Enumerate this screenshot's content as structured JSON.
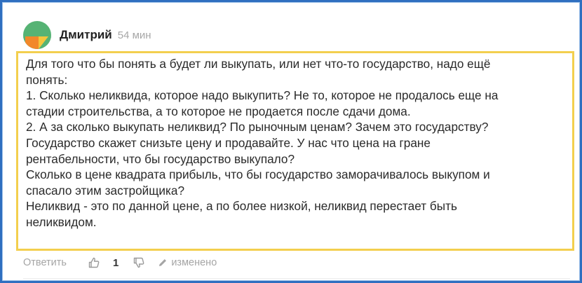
{
  "comment": {
    "author": "Дмитрий",
    "time": "54 мин",
    "avatar_icon": "avatar-circle",
    "avatar_colors": [
      "#56b374",
      "#f2882a",
      "#f4c63c"
    ],
    "body_lines": [
      "Для того что бы понять а будет ли выкупать, или нет что-то государство, надо ещё",
      "понять:",
      "1. Сколько неликвида, которое надо выкупить? Не то, которое не продалось еще на",
      "стадии строительства, а то которое не продается после сдачи дома.",
      "2. А за сколько выкупать неликвид? По рыночным ценам? Зачем это государству?",
      "Государство скажет снизьте цену и продавайте. У нас что цена на гране",
      "рентабельности, что бы государство выкупало?",
      "Сколько в цене квадрата прибыль, что бы государство заморачивалось выкупом и",
      "спасало этим застройщика?",
      "Неликвид - это по данной цене, а по более низкой, неликвид перестает быть",
      "неликвидом."
    ],
    "highlight_color": "#f3cf4e"
  },
  "actions": {
    "reply_label": "Ответить",
    "like_icon": "thumbs-up-icon",
    "like_count": "1",
    "dislike_icon": "thumbs-down-icon",
    "edit_icon": "pencil-icon",
    "edited_label": "изменено"
  },
  "frame_color": "#2f6fc0"
}
